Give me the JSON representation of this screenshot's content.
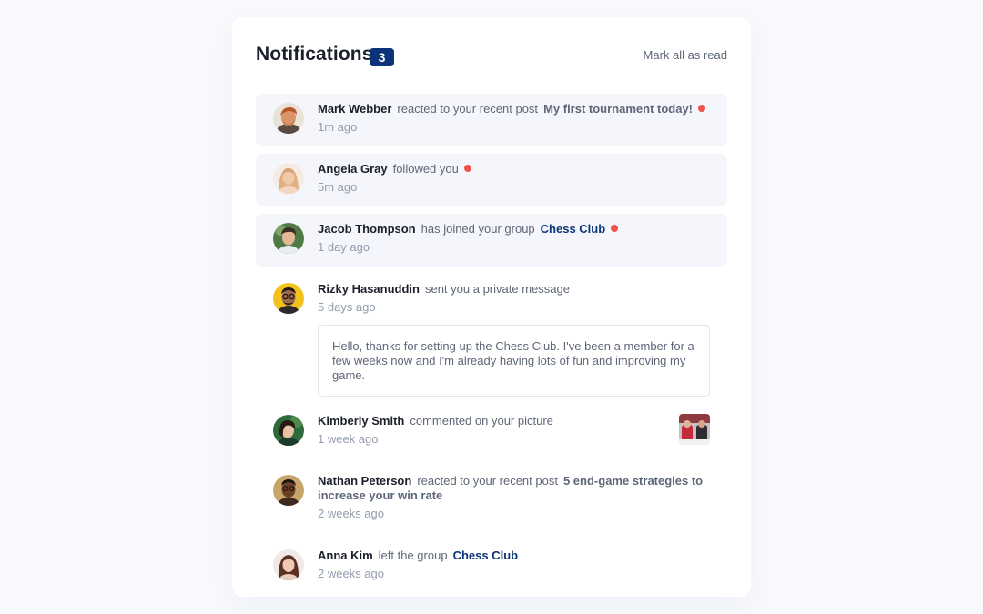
{
  "header": {
    "title": "Notifications",
    "unread_count": "3",
    "mark_all_label": "Mark all as read"
  },
  "notifications": [
    {
      "name": "Mark Webber",
      "action": "reacted to your recent post",
      "target": "My first tournament today!",
      "time": "1m ago",
      "unread": true
    },
    {
      "name": "Angela Gray",
      "action": "followed you",
      "target": "",
      "time": "5m ago",
      "unread": true
    },
    {
      "name": "Jacob Thompson",
      "action": "has joined your group",
      "target": "Chess Club",
      "time": "1 day ago",
      "unread": true
    },
    {
      "name": "Rizky Hasanuddin",
      "action": "sent you a private message",
      "target": "",
      "time": "5 days ago",
      "unread": false,
      "message": "Hello, thanks for setting up the Chess Club. I've been a member for a few weeks now and I'm already having lots of fun and improving my game."
    },
    {
      "name": "Kimberly Smith",
      "action": "commented on your picture",
      "target": "",
      "time": "1 week ago",
      "unread": false
    },
    {
      "name": "Nathan Peterson",
      "action": "reacted to your recent post",
      "target": "5 end-game strategies to increase your win rate",
      "time": "2 weeks ago",
      "unread": false
    },
    {
      "name": "Anna Kim",
      "action": "left the group",
      "target": "Chess Club",
      "time": "2 weeks ago",
      "unread": false
    }
  ],
  "colors": {
    "badge": "#0b3478",
    "unread_bg": "#f4f6fb",
    "unread_dot": "#f0524b",
    "group_link": "#0b3478"
  }
}
